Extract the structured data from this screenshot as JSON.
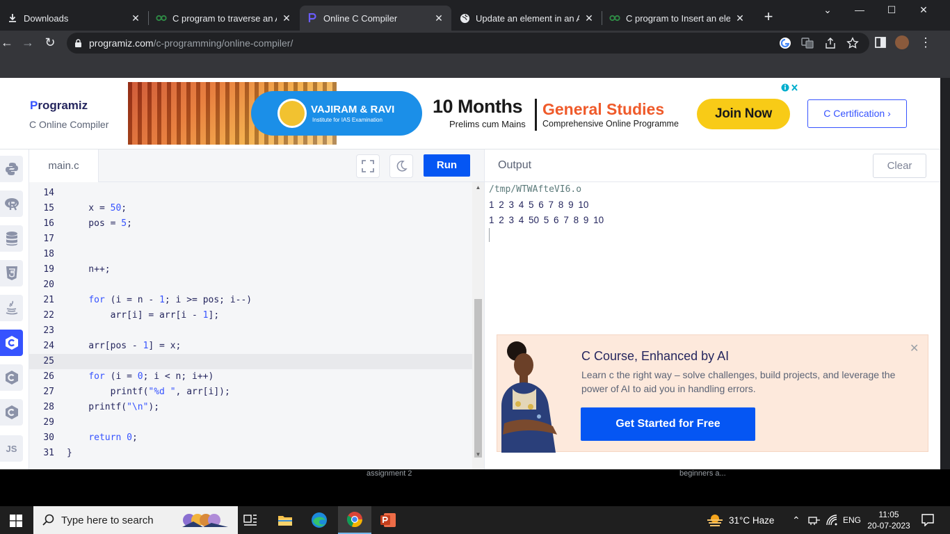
{
  "browser": {
    "tabs": [
      {
        "title": "Downloads",
        "icon": "download-icon",
        "active": false
      },
      {
        "title": "C program to traverse an Arr",
        "icon": "geeksforgeeks-icon",
        "active": false
      },
      {
        "title": "Online C Compiler",
        "icon": "programiz-icon",
        "active": true
      },
      {
        "title": "Update an element in an Arr",
        "icon": "globe-icon",
        "active": false
      },
      {
        "title": "C program to Insert an eleme",
        "icon": "geeksforgeeks-icon",
        "active": false
      }
    ],
    "url_host": "programiz.com",
    "url_path": "/c-programming/online-compiler/"
  },
  "site": {
    "logo": "rogramiz",
    "logo_p": "P",
    "subtitle": "C Online Compiler",
    "cert_button": "C Certification ›"
  },
  "ad": {
    "brand": "VAJIRAM & RAVI",
    "tagline": "Institute for IAS Examination",
    "headline": "10 Months",
    "sub1": "Prelims cum Mains",
    "headline2": "General Studies",
    "sub2": "Comprehensive Online Programme",
    "cta": "Join Now"
  },
  "rail": {
    "items": [
      "python-icon",
      "r-icon",
      "sql-icon",
      "html5-icon",
      "java-icon",
      "c-icon",
      "cpp-icon",
      "csharp-icon",
      "js-icon"
    ],
    "active": "c-icon",
    "js_label": "JS"
  },
  "editor": {
    "file_tab": "main.c",
    "run_label": "Run",
    "current_line": 25,
    "lines": [
      {
        "n": "14",
        "code": ""
      },
      {
        "n": "15",
        "code": "x = 50;"
      },
      {
        "n": "16",
        "code": "pos = 5;"
      },
      {
        "n": "17",
        "code": ""
      },
      {
        "n": "18",
        "code": ""
      },
      {
        "n": "19",
        "code": "n++;"
      },
      {
        "n": "20",
        "code": ""
      },
      {
        "n": "21",
        "code": "for (i = n - 1; i >= pos; i--)"
      },
      {
        "n": "22",
        "code": "    arr[i] = arr[i - 1];"
      },
      {
        "n": "23",
        "code": ""
      },
      {
        "n": "24",
        "code": "arr[pos - 1] = x;"
      },
      {
        "n": "25",
        "code": ""
      },
      {
        "n": "26",
        "code": "for (i = 0; i < n; i++)"
      },
      {
        "n": "27",
        "code": "    printf(\"%d \", arr[i]);"
      },
      {
        "n": "28",
        "code": "printf(\"\\n\");"
      },
      {
        "n": "29",
        "code": ""
      },
      {
        "n": "30",
        "code": "return 0;"
      },
      {
        "n": "31",
        "code": "}"
      }
    ]
  },
  "output": {
    "title": "Output",
    "clear_label": "Clear",
    "lines": [
      "/tmp/WTWAfteVI6.o",
      "1 2 3 4 5 6 7 8 9 10",
      "1 2 3 4 50 5 6 7 8 9 10"
    ]
  },
  "promo": {
    "title": "C Course, Enhanced by AI",
    "description": "Learn c the right way – solve challenges, build projects, and leverage the power of AI to aid you in handling errors.",
    "cta": "Get Started for Free"
  },
  "below_text": [
    "assignment 2",
    "beginners a..."
  ],
  "taskbar": {
    "search_placeholder": "Type here to search",
    "weather": "31°C  Haze",
    "lang": "ENG",
    "time": "11:05",
    "date": "20-07-2023"
  },
  "colors": {
    "accent": "#3653ff",
    "run_button": "#0556f3",
    "join_now": "#f8cb17",
    "general_studies": "#ef5a2a"
  }
}
